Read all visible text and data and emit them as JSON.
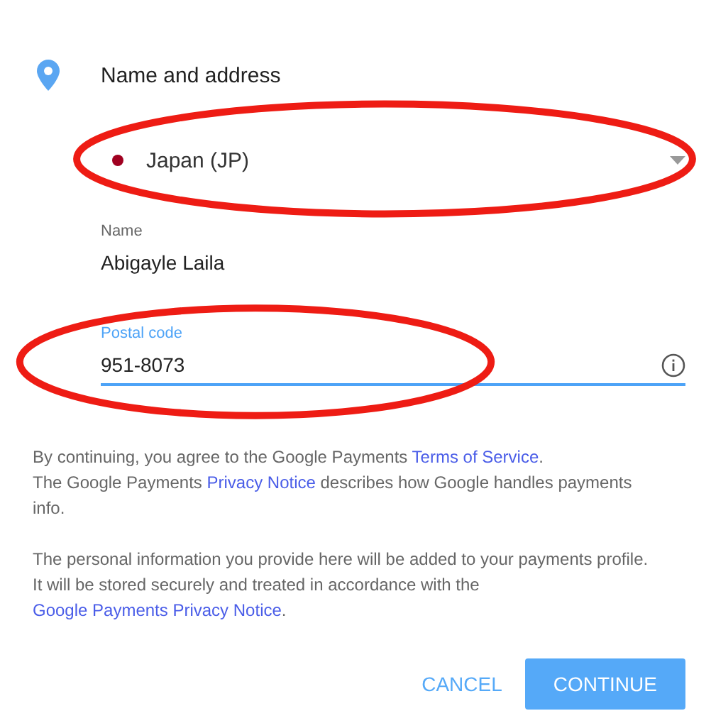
{
  "section": {
    "title": "Name and address"
  },
  "country": {
    "value": "Japan (JP)",
    "color": "#a00020",
    "circled": true
  },
  "name_field": {
    "label": "Name",
    "value": "Abigayle Laila",
    "focused": false
  },
  "postal_field": {
    "label": "Postal code",
    "value": "951-8073",
    "focused": true,
    "circled": true
  },
  "legal": [
    {
      "paragraphs": [
        {
          "segments": [
            {
              "kind": "text",
              "text": "By continuing, you agree to the Google Payments "
            },
            {
              "kind": "link",
              "text": "Terms of Service"
            },
            {
              "kind": "text",
              "text": "."
            }
          ]
        },
        {
          "segments": [
            {
              "kind": "text",
              "text": "The Google Payments "
            },
            {
              "kind": "link",
              "text": "Privacy Notice"
            },
            {
              "kind": "text",
              "text": " describes how Google handles payments info."
            }
          ]
        }
      ]
    },
    {
      "paragraphs": [
        {
          "segments": [
            {
              "kind": "text",
              "text": "The personal information you provide here will be added to your payments profile. It will be stored securely and treated in accordance with the "
            },
            {
              "kind": "link",
              "text": "Google Payments Privacy Notice"
            },
            {
              "kind": "text",
              "text": "."
            }
          ]
        }
      ]
    }
  ],
  "buttons": [
    {
      "kind": "flat",
      "label": "CANCEL"
    },
    {
      "kind": "raised",
      "label": "CONTINUE"
    }
  ]
}
